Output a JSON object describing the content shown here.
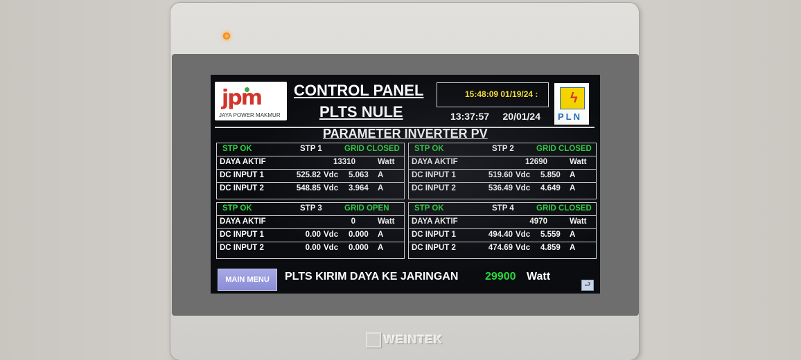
{
  "device": {
    "brand": "WEINTEK"
  },
  "header": {
    "company_logo": {
      "mark": "jpm",
      "text": "JAYA POWER MAKMUR"
    },
    "title_line1": "CONTROL PANEL",
    "title_line2": "PLTS NULE",
    "clock_top": "15:48:09  01/19/24  :",
    "clock_time": "13:37:57",
    "clock_date": "20/01/24",
    "pln_logo_text": "PLN"
  },
  "subtitle": "PARAMETER INVERTER PV",
  "labels": {
    "daya_aktif": "DAYA AKTIF",
    "dc_input_1": "DC INPUT 1",
    "dc_input_2": "DC INPUT 2",
    "watt": "Watt",
    "vdc": "Vdc",
    "amp": "A"
  },
  "inverters": [
    {
      "status": "STP OK",
      "name": "STP 1",
      "grid": "GRID CLOSED",
      "daya_aktif": "13310",
      "dc1_v": "525.82",
      "dc1_a": "5.063",
      "dc2_v": "548.85",
      "dc2_a": "3.964"
    },
    {
      "status": "STP OK",
      "name": "STP 2",
      "grid": "GRID CLOSED",
      "daya_aktif": "12690",
      "dc1_v": "519.60",
      "dc1_a": "5.850",
      "dc2_v": "536.49",
      "dc2_a": "4.649"
    },
    {
      "status": "STP OK",
      "name": "STP 3",
      "grid": "GRID OPEN",
      "daya_aktif": "0",
      "dc1_v": "0.00",
      "dc1_a": "0.000",
      "dc2_v": "0.00",
      "dc2_a": "0.000"
    },
    {
      "status": "STP OK",
      "name": "STP 4",
      "grid": "GRID CLOSED",
      "daya_aktif": "4970",
      "dc1_v": "494.40",
      "dc1_a": "5.559",
      "dc2_v": "474.69",
      "dc2_a": "4.859"
    }
  ],
  "footer": {
    "main_menu_label": "MAIN MENU",
    "export_label": "PLTS KIRIM DAYA KE JARINGAN",
    "export_value": "29900",
    "export_unit": "Watt",
    "back_icon": "return-arrow-icon"
  },
  "colors": {
    "screen_bg": "#0a0c10",
    "ok_green": "#2bd93e",
    "clock_yellow": "#f4e13a",
    "button_lavender": "#9a9ce0"
  }
}
